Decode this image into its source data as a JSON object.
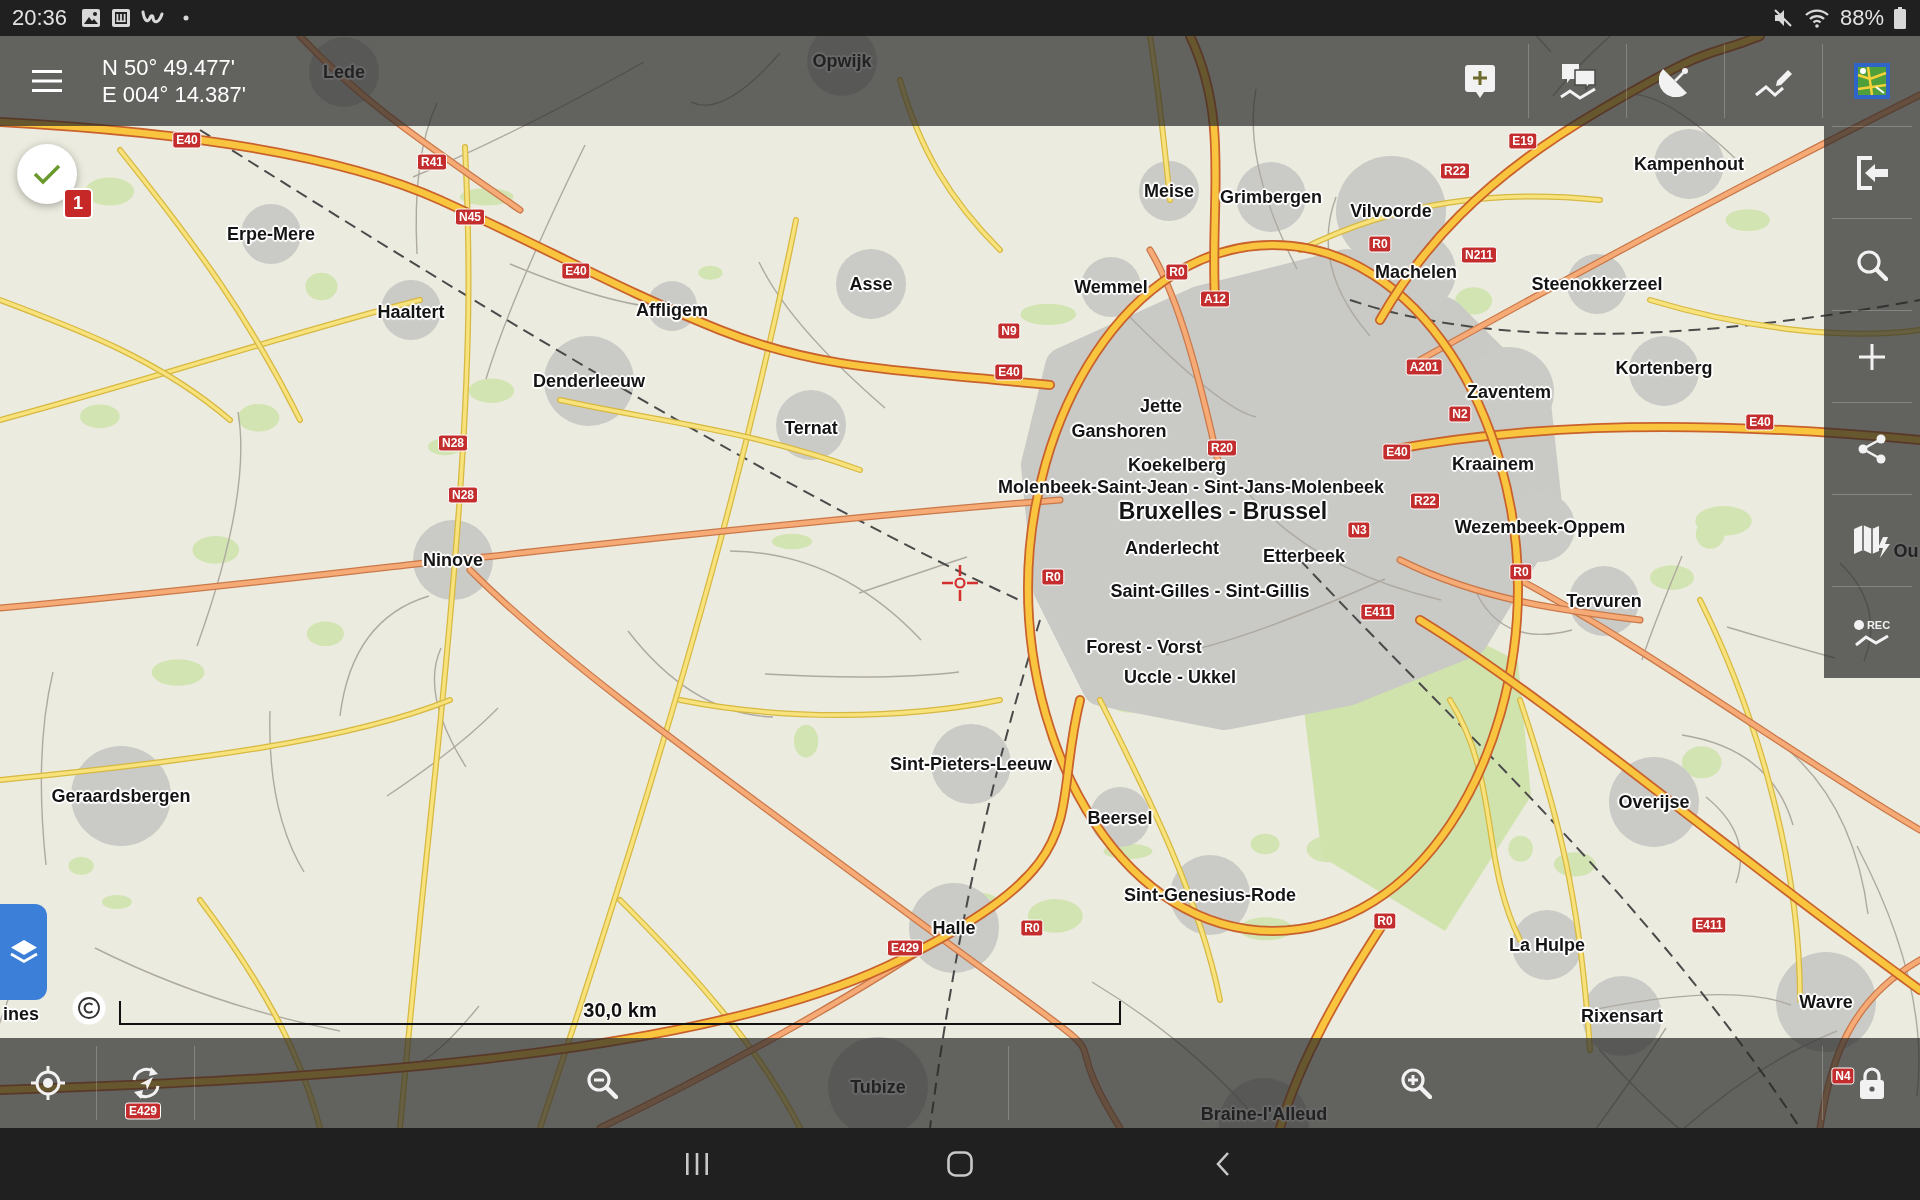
{
  "status_bar": {
    "time": "20:36",
    "battery": "88%"
  },
  "toolbar": {
    "latitude": "N 50° 49.477'",
    "longitude": "E 004° 14.387'"
  },
  "map": {
    "places": [
      {
        "name": "Lede",
        "kind": "town"
      },
      {
        "name": "Opwijk",
        "kind": "town"
      },
      {
        "name": "Kampenhout",
        "kind": "town"
      },
      {
        "name": "Meise",
        "kind": "town"
      },
      {
        "name": "Grimbergen",
        "kind": "town"
      },
      {
        "name": "Vilvoorde",
        "kind": "town"
      },
      {
        "name": "Erpe-Mere",
        "kind": "town"
      },
      {
        "name": "Asse",
        "kind": "town"
      },
      {
        "name": "Wemmel",
        "kind": "town"
      },
      {
        "name": "Machelen",
        "kind": "town"
      },
      {
        "name": "Steenokkerzeel",
        "kind": "town"
      },
      {
        "name": "Haaltert",
        "kind": "town"
      },
      {
        "name": "Affligem",
        "kind": "town"
      },
      {
        "name": "Denderleeuw",
        "kind": "town"
      },
      {
        "name": "Kortenberg",
        "kind": "town"
      },
      {
        "name": "Jette",
        "kind": "town"
      },
      {
        "name": "Zaventem",
        "kind": "town"
      },
      {
        "name": "Ternat",
        "kind": "town"
      },
      {
        "name": "Ganshoren",
        "kind": "town"
      },
      {
        "name": "Koekelberg",
        "kind": "town"
      },
      {
        "name": "Kraainem",
        "kind": "town"
      },
      {
        "name": "Molenbeek-Saint-Jean - Sint-Jans-Molenbeek",
        "kind": "town"
      },
      {
        "name": "Bruxelles - Brussel",
        "kind": "city"
      },
      {
        "name": "Wezembeek-Oppem",
        "kind": "town"
      },
      {
        "name": "Ninove",
        "kind": "town"
      },
      {
        "name": "Anderlecht",
        "kind": "town"
      },
      {
        "name": "Etterbeek",
        "kind": "town"
      },
      {
        "name": "Ou",
        "kind": "town"
      },
      {
        "name": "Saint-Gilles - Sint-Gillis",
        "kind": "town"
      },
      {
        "name": "Tervuren",
        "kind": "town"
      },
      {
        "name": "Forest - Vorst",
        "kind": "town"
      },
      {
        "name": "Uccle - Ukkel",
        "kind": "town"
      },
      {
        "name": "Sint-Pieters-Leeuw",
        "kind": "town"
      },
      {
        "name": "Geraardsbergen",
        "kind": "town"
      },
      {
        "name": "Beersel",
        "kind": "town"
      },
      {
        "name": "Overijse",
        "kind": "town"
      },
      {
        "name": "Sint-Genesius-Rode",
        "kind": "town"
      },
      {
        "name": "Halle",
        "kind": "town"
      },
      {
        "name": "La Hulpe",
        "kind": "town"
      },
      {
        "name": "ines",
        "kind": "town"
      },
      {
        "name": "Rixensart",
        "kind": "town"
      },
      {
        "name": "Wavre",
        "kind": "town"
      },
      {
        "name": "Tubize",
        "kind": "town"
      },
      {
        "name": "Braine-l'Alleud",
        "kind": "town"
      }
    ],
    "road_shields": [
      "E40",
      "E19",
      "R41",
      "R22",
      "N45",
      "R0",
      "E40",
      "R0",
      "N211",
      "A12",
      "N9",
      "E40",
      "A201",
      "N2",
      "E40",
      "N28",
      "R20",
      "E40",
      "N28",
      "R22",
      "N3",
      "R0",
      "R0",
      "E411",
      "R0",
      "R0",
      "E411",
      "E429",
      "N4",
      "E429"
    ],
    "scale": "30,0 km",
    "waypoint_count": "1"
  },
  "sidebar": {
    "record_label": "REC"
  }
}
